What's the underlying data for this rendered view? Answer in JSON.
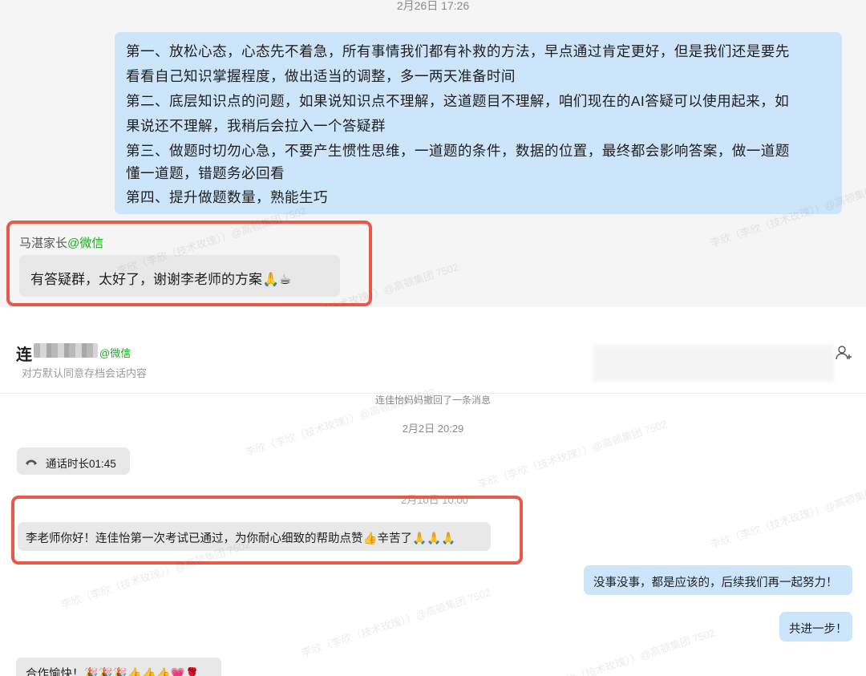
{
  "top_chat": {
    "timestamp": "2月26日 17:26",
    "outgoing_lines": [
      "第一、放松心态，心态先不着急，所有事情我们都有补救的方法，早点通过肯定更好，但是我们还是要先",
      "看看自己知识掌握程度，做出适当的调整，多一两天准备时间",
      "第二、底层知识点的问题，如果说知识点不理解，这道题目不理解，咱们现在的AI答疑可以使用起来，如",
      "果说还不理解，我稍后会拉入一个答疑群",
      "第三、做题时切勿心急，不要产生惯性思维，一道题的条件，数据的位置，最终都会影响答案，做一道题",
      "懂一道题，错题务必回看",
      "第四、提升做题数量，熟能生巧"
    ],
    "sender_name": "马湛家长",
    "sender_tag": "@微信",
    "incoming_text": "有答疑群，太好了，谢谢李老师的方案🙏☕"
  },
  "bottom_chat": {
    "contact_name": "连",
    "contact_tag": "@微信",
    "archive_note": "对方默认同意存档会话内容",
    "recall_notice": "连佳怡妈妈撤回了一条消息",
    "timestamp": "2月2日 20:29",
    "call_text": "通话时长01:45",
    "partial_timestamp": "2月10日 10:00",
    "parent_message": "李老师你好！连佳怡第一次考试已通过，为你耐心细致的帮助点赞👍辛苦了🙏🙏🙏",
    "reply_1": "没事没事，都是应该的，后续我们再一起努力！",
    "reply_2": "共进一步！",
    "coop_message": "合作愉快！🎉🎉🎉👍👍👍💗🌹"
  },
  "watermark": "李欣（李欣（技术玫瑰））@高顿集团 7502",
  "colors": {
    "outgoing_bubble": "#cde5fb",
    "incoming_bubble": "#e8e8e8",
    "highlight_border": "#e8584b",
    "wechat_tag": "#1aad19"
  },
  "icons": [
    "add-contact-icon",
    "phone-icon"
  ]
}
